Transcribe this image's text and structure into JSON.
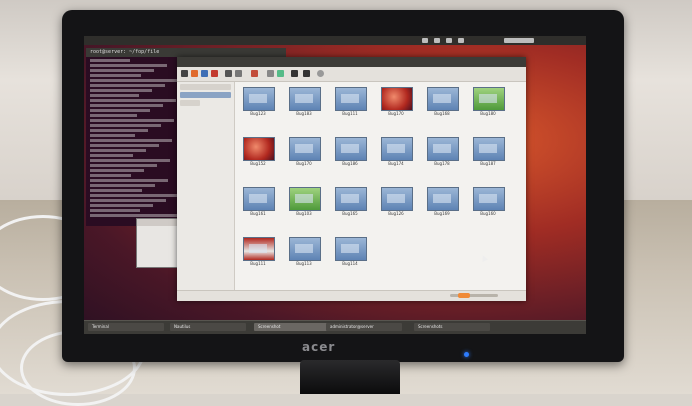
{
  "monitor": {
    "brand": "acer"
  },
  "terminal": {
    "title": "root@server: ~/fop/file"
  },
  "file_manager": {
    "files": [
      {
        "name": "Bug123",
        "type": "image"
      },
      {
        "name": "Bug183",
        "type": "image"
      },
      {
        "name": "Bug111",
        "type": "image"
      },
      {
        "name": "Bug170",
        "type": "red"
      },
      {
        "name": "Bug168",
        "type": "image"
      },
      {
        "name": "Bug180",
        "type": "green"
      },
      {
        "name": "Bug152",
        "type": "red"
      },
      {
        "name": "Bug170",
        "type": "image"
      },
      {
        "name": "Bug186",
        "type": "image"
      },
      {
        "name": "Bug174",
        "type": "image"
      },
      {
        "name": "Bug178",
        "type": "image"
      },
      {
        "name": "Bug187",
        "type": "image"
      },
      {
        "name": "Bug161",
        "type": "image"
      },
      {
        "name": "Bug103",
        "type": "green"
      },
      {
        "name": "Bug165",
        "type": "image"
      },
      {
        "name": "Bug126",
        "type": "image"
      },
      {
        "name": "Bug169",
        "type": "image"
      },
      {
        "name": "Bug160",
        "type": "image"
      },
      {
        "name": "Bug111",
        "type": "red-screen"
      },
      {
        "name": "Bug113",
        "type": "image"
      },
      {
        "name": "Bug114",
        "type": "image"
      }
    ]
  },
  "taskbar": {
    "tasks": [
      "Terminal",
      "Nautilus",
      "Screenshot",
      "administrator@server",
      "Screenshots"
    ]
  }
}
